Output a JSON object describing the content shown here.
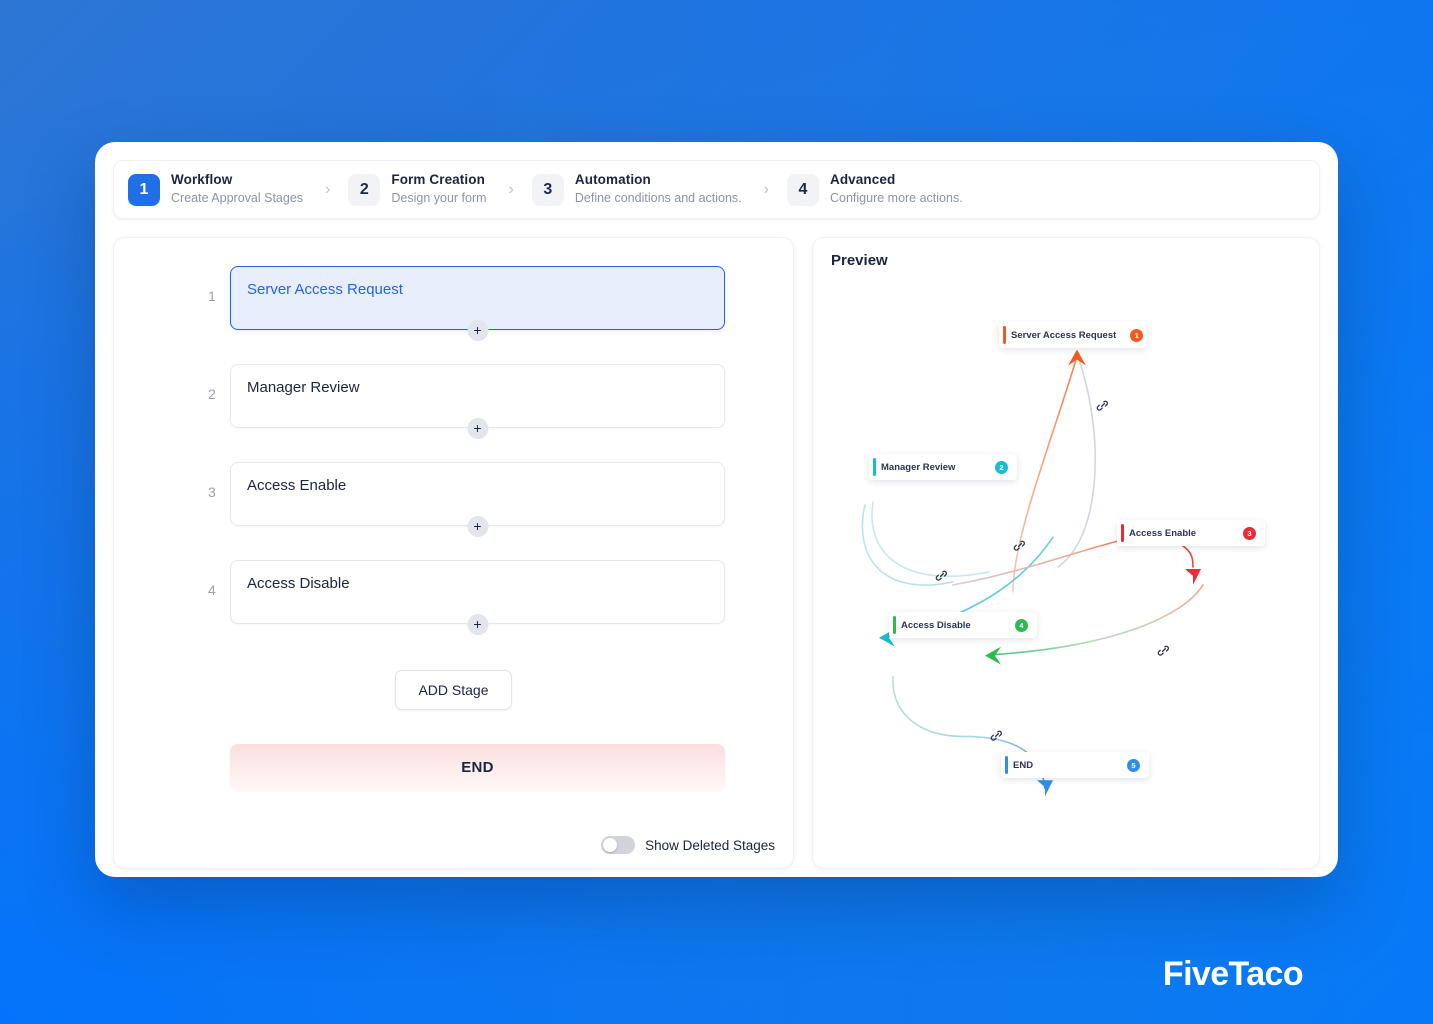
{
  "stepper": {
    "separator": "›",
    "steps": [
      {
        "num": "1",
        "title": "Workflow",
        "sub": "Create Approval Stages"
      },
      {
        "num": "2",
        "title": "Form Creation",
        "sub": "Design your form"
      },
      {
        "num": "3",
        "title": "Automation",
        "sub": "Define conditions and actions."
      },
      {
        "num": "4",
        "title": "Advanced",
        "sub": "Configure more actions."
      }
    ]
  },
  "editor": {
    "stages": [
      {
        "num": "1",
        "name": "Server Access Request"
      },
      {
        "num": "2",
        "name": "Manager Review"
      },
      {
        "num": "3",
        "name": "Access Enable"
      },
      {
        "num": "4",
        "name": "Access Disable"
      }
    ],
    "plus_glyph": "+",
    "add_stage_label": "ADD Stage",
    "end_label": "END",
    "toggle_label": "Show Deleted Stages",
    "toggle_state": "off"
  },
  "preview": {
    "title": "Preview",
    "nodes": [
      {
        "label": "Server Access Request",
        "badge": "1",
        "color": "#f4591f"
      },
      {
        "label": "Manager Review",
        "badge": "2",
        "color": "#19bdd2"
      },
      {
        "label": "Access Enable",
        "badge": "3",
        "color": "#eb2b35"
      },
      {
        "label": "Access Disable",
        "badge": "4",
        "color": "#2dba50"
      },
      {
        "label": "END",
        "badge": "5",
        "color": "#2f8fe8"
      }
    ],
    "link_icon": "link-icon"
  },
  "branding": {
    "logo": "FiveTaco"
  },
  "colors": {
    "accent_blue": "#1f6fe5",
    "selected_fill": "#e8eefc",
    "selected_border": "#2563eb",
    "end_pink": "#fbdede",
    "node1": "#f4591f",
    "node2": "#19bdd2",
    "node3": "#eb2b35",
    "node4": "#2dba50",
    "node5": "#2f8fe8"
  }
}
